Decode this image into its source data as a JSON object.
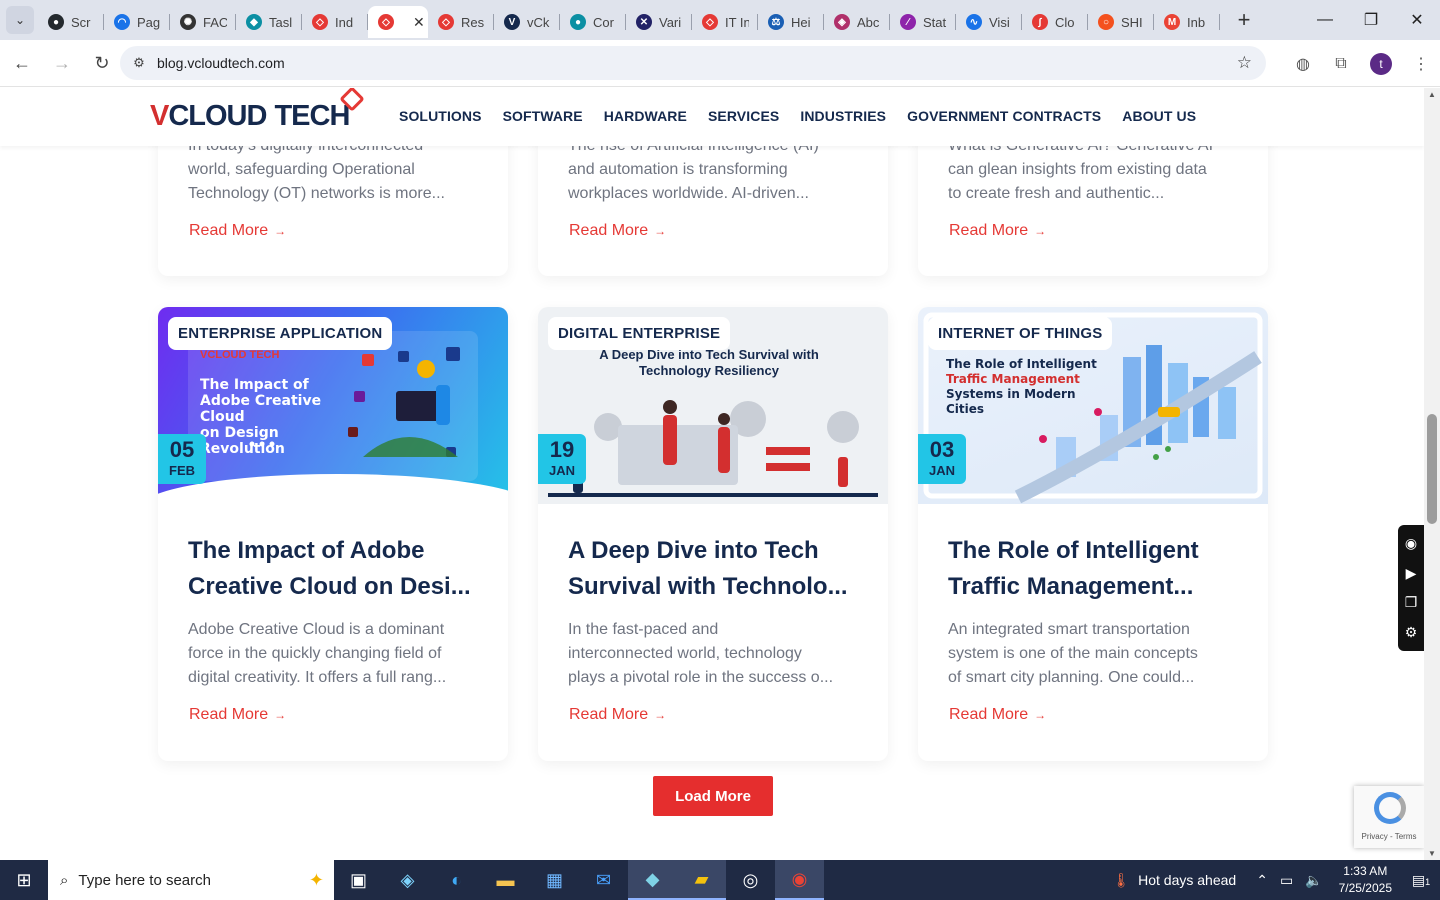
{
  "browser": {
    "tabs": [
      {
        "title": "Scr",
        "icon": "github-icon",
        "color": "#24292e"
      },
      {
        "title": "Pag",
        "icon": "pagespeed-icon",
        "color": "#1a73e8"
      },
      {
        "title": "FAC",
        "icon": "openai-icon",
        "color": "#333333"
      },
      {
        "title": "Tasl",
        "icon": "task-icon",
        "color": "#0b8fa3"
      },
      {
        "title": "Ind",
        "icon": "vcloud-icon",
        "color": "#e53935"
      },
      {
        "title": "",
        "icon": "vcloud-icon",
        "color": "#e53935",
        "active": true
      },
      {
        "title": "Res",
        "icon": "vcloud-icon",
        "color": "#e53935"
      },
      {
        "title": "vCk",
        "icon": "vcloud-v-icon",
        "color": "#15294d"
      },
      {
        "title": "Cor",
        "icon": "contact-icon",
        "color": "#0b8fa3"
      },
      {
        "title": "Vari",
        "icon": "x-icon",
        "color": "#222266"
      },
      {
        "title": "IT In",
        "icon": "vcloud-icon",
        "color": "#e53935"
      },
      {
        "title": "Hei",
        "icon": "scales-icon",
        "color": "#1a5fb4"
      },
      {
        "title": "Abc",
        "icon": "abc-icon",
        "color": "#b0306a"
      },
      {
        "title": "Stat",
        "icon": "stat-icon",
        "color": "#8e24aa"
      },
      {
        "title": "Visi",
        "icon": "pulse-icon",
        "color": "#1a73e8"
      },
      {
        "title": "Clo",
        "icon": "cloud-script-icon",
        "color": "#e53935"
      },
      {
        "title": "SHI",
        "icon": "circle-icon",
        "color": "#f4511e"
      },
      {
        "title": "Inb",
        "icon": "gmail-icon",
        "color": "#ea4335"
      }
    ],
    "url": "blog.vcloudtech.com"
  },
  "site": {
    "logo": {
      "part1": "V",
      "part2": "CLOUD",
      "part3": "TECH"
    },
    "nav": [
      "SOLUTIONS",
      "SOFTWARE",
      "HARDWARE",
      "SERVICES",
      "INDUSTRIES",
      "GOVERNMENT CONTRACTS",
      "ABOUT US"
    ]
  },
  "top_cards": [
    {
      "lines": [
        "In today's digitally interconnected",
        "world, safeguarding Operational",
        "Technology (OT) networks is more..."
      ],
      "read_more": "Read More"
    },
    {
      "lines": [
        "The rise of Artificial Intelligence (AI)",
        "and automation is transforming",
        "workplaces worldwide. AI-driven..."
      ],
      "read_more": "Read More"
    },
    {
      "lines": [
        "What is Generative AI? Generative AI",
        "can glean insights from existing data",
        "to create fresh and authentic..."
      ],
      "read_more": "Read More"
    }
  ],
  "cards": [
    {
      "category": "ENTERPRISE APPLICATION",
      "day": "05",
      "month": "FEB",
      "thumb_brand": "VCLOUD TECH",
      "thumb_lines": [
        "The Impact of",
        "Adobe Creative Cloud",
        "on Design Revolution"
      ],
      "title_lines": [
        "The Impact of Adobe",
        "Creative Cloud on Desi..."
      ],
      "excerpt": [
        "Adobe Creative Cloud is a dominant",
        "force in the quickly changing field of",
        "digital creativity. It offers a full rang..."
      ],
      "read_more": "Read More"
    },
    {
      "category": "DIGITAL ENTERPRISE",
      "day": "19",
      "month": "JAN",
      "thumb_lines": [
        "A Deep Dive into Tech Survival with",
        "Technology Resiliency"
      ],
      "title_lines": [
        "A Deep Dive into Tech",
        "Survival with Technolo..."
      ],
      "excerpt": [
        "In the fast-paced and",
        "interconnected world, technology",
        "plays a pivotal role in the success o..."
      ],
      "read_more": "Read More"
    },
    {
      "category": "INTERNET OF THINGS",
      "day": "03",
      "month": "JAN",
      "thumb_lines": [
        "The Role of Intelligent",
        "Traffic Management",
        "Systems in Modern Cities"
      ],
      "title_lines": [
        "The Role of Intelligent",
        "Traffic Management..."
      ],
      "excerpt": [
        "An integrated smart transportation",
        "system is one of the main concepts",
        "of smart city planning. One could..."
      ],
      "read_more": "Read More"
    }
  ],
  "load_more": "Load More",
  "recaptcha": "Privacy - Terms",
  "taskbar": {
    "search_placeholder": "Type here to search",
    "weather": "Hot days ahead",
    "time": "1:33 AM",
    "date": "7/25/2025",
    "notifications": "1"
  },
  "colors": {
    "accent": "#e53935",
    "navy": "#15294d",
    "badge": "#22c5e6"
  }
}
